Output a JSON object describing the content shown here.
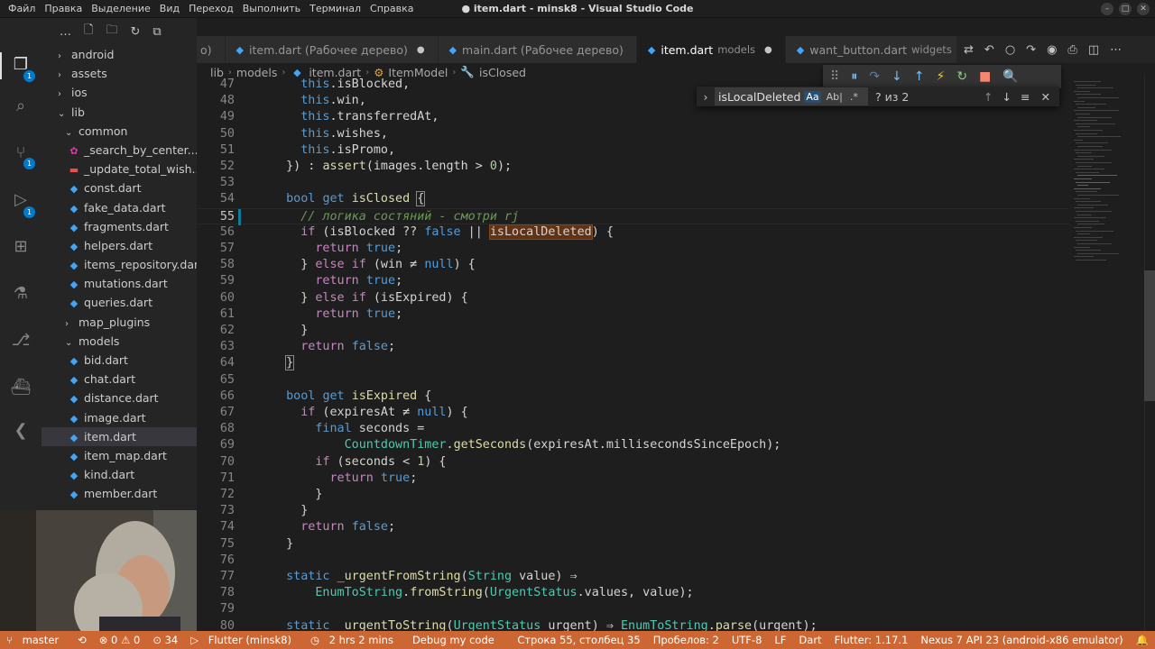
{
  "window": {
    "title": "● item.dart - minsk8 - Visual Studio Code",
    "menu": [
      "Файл",
      "Правка",
      "Выделение",
      "Вид",
      "Переход",
      "Выполнить",
      "Терминал",
      "Справка"
    ]
  },
  "activity_bar": {
    "items": [
      {
        "icon": "files-icon",
        "badge": "1"
      },
      {
        "icon": "search-icon"
      },
      {
        "icon": "source-control-icon",
        "badge": "1"
      },
      {
        "icon": "run-debug-icon",
        "badge": "1"
      },
      {
        "icon": "extensions-icon"
      },
      {
        "icon": "testing-icon"
      },
      {
        "icon": "git-graph-icon"
      },
      {
        "icon": "docker-icon"
      },
      {
        "icon": "flutter-icon"
      }
    ]
  },
  "sidebar": {
    "tree": [
      {
        "label": "android",
        "type": "folder",
        "level": 1,
        "expanded": false
      },
      {
        "label": "assets",
        "type": "folder",
        "level": 1,
        "expanded": false
      },
      {
        "label": "ios",
        "type": "folder",
        "level": 1,
        "expanded": false
      },
      {
        "label": "lib",
        "type": "folder",
        "level": 1,
        "expanded": true
      },
      {
        "label": "common",
        "type": "folder",
        "level": 2,
        "expanded": true
      },
      {
        "label": "_search_by_center....",
        "type": "graphql",
        "level": 3
      },
      {
        "label": "_update_total_wish...",
        "type": "red",
        "level": 3
      },
      {
        "label": "const.dart",
        "type": "dart",
        "level": 3
      },
      {
        "label": "fake_data.dart",
        "type": "dart",
        "level": 3
      },
      {
        "label": "fragments.dart",
        "type": "dart",
        "level": 3
      },
      {
        "label": "helpers.dart",
        "type": "dart",
        "level": 3
      },
      {
        "label": "items_repository.dart",
        "type": "dart",
        "level": 3
      },
      {
        "label": "mutations.dart",
        "type": "dart",
        "level": 3
      },
      {
        "label": "queries.dart",
        "type": "dart",
        "level": 3
      },
      {
        "label": "map_plugins",
        "type": "folder",
        "level": 2,
        "expanded": false
      },
      {
        "label": "models",
        "type": "folder",
        "level": 2,
        "expanded": true
      },
      {
        "label": "bid.dart",
        "type": "dart",
        "level": 3
      },
      {
        "label": "chat.dart",
        "type": "dart",
        "level": 3
      },
      {
        "label": "distance.dart",
        "type": "dart",
        "level": 3
      },
      {
        "label": "image.dart",
        "type": "dart",
        "level": 3
      },
      {
        "label": "item.dart",
        "type": "dart",
        "level": 3,
        "selected": true
      },
      {
        "label": "item_map.dart",
        "type": "dart",
        "level": 3
      },
      {
        "label": "kind.dart",
        "type": "dart",
        "level": 3
      },
      {
        "label": "member.dart",
        "type": "dart",
        "level": 3
      }
    ]
  },
  "tabs": [
    {
      "label": "o)",
      "desc": "",
      "modified": false,
      "active": false
    },
    {
      "label": "item.dart (Рабочее дерево)",
      "desc": "",
      "modified": true,
      "active": false
    },
    {
      "label": "main.dart (Рабочее дерево)",
      "desc": "",
      "modified": false,
      "active": false
    },
    {
      "label": "item.dart",
      "desc": "models",
      "modified": true,
      "active": true
    },
    {
      "label": "want_button.dart",
      "desc": "widgets",
      "modified": false,
      "active": false
    }
  ],
  "breadcrumb": [
    "lib",
    "models",
    "item.dart",
    "ItemModel",
    "isClosed"
  ],
  "find": {
    "value": "isLocalDeleted",
    "opts": [
      "Aa",
      "Ab|",
      ".*"
    ],
    "result": "? из 2"
  },
  "editor": {
    "current_line": 55,
    "lines": [
      {
        "n": "47",
        "html": "    <span class='kw'>this</span>.isBlocked,"
      },
      {
        "n": "48",
        "html": "    <span class='kw'>this</span>.win,"
      },
      {
        "n": "49",
        "html": "    <span class='kw'>this</span>.transferredAt,"
      },
      {
        "n": "50",
        "html": "    <span class='kw'>this</span>.wishes,"
      },
      {
        "n": "51",
        "html": "    <span class='kw'>this</span>.isPromo,"
      },
      {
        "n": "52",
        "html": "  }) : <span class='fn'>assert</span>(images.length &gt; <span class='num'>0</span>);"
      },
      {
        "n": "53",
        "html": ""
      },
      {
        "n": "54",
        "html": "  <span class='kw'>bool</span> <span class='kw'>get</span> <span class='fn'>isClosed</span> <span class='brk'>{</span>"
      },
      {
        "n": "55",
        "html": "    <span class='cm'>// логика состяний - смотри rj</span>"
      },
      {
        "n": "56",
        "html": "    <span class='ctl'>if</span> (isBlocked ?? <span class='kw'>false</span> || <span class='hl'>isLocalDeleted</span>) {"
      },
      {
        "n": "57",
        "html": "      <span class='ctl'>return</span> <span class='kw'>true</span>;"
      },
      {
        "n": "58",
        "html": "    } <span class='ctl'>else</span> <span class='ctl'>if</span> (win ≠ <span class='kw'>null</span>) {"
      },
      {
        "n": "59",
        "html": "      <span class='ctl'>return</span> <span class='kw'>true</span>;"
      },
      {
        "n": "60",
        "html": "    } <span class='ctl'>else</span> <span class='ctl'>if</span> (isExpired) {"
      },
      {
        "n": "61",
        "html": "      <span class='ctl'>return</span> <span class='kw'>true</span>;"
      },
      {
        "n": "62",
        "html": "    }"
      },
      {
        "n": "63",
        "html": "    <span class='ctl'>return</span> <span class='kw'>false</span>;"
      },
      {
        "n": "64",
        "html": "  <span class='brk'>}</span>"
      },
      {
        "n": "65",
        "html": ""
      },
      {
        "n": "66",
        "html": "  <span class='kw'>bool</span> <span class='kw'>get</span> <span class='fn'>isExpired</span> {"
      },
      {
        "n": "67",
        "html": "    <span class='ctl'>if</span> (expiresAt ≠ <span class='kw'>null</span>) {"
      },
      {
        "n": "68",
        "html": "      <span class='kw'>final</span> seconds ="
      },
      {
        "n": "69",
        "html": "          <span class='ty'>CountdownTimer</span>.<span class='fn'>getSeconds</span>(expiresAt.millisecondsSinceEpoch);"
      },
      {
        "n": "70",
        "html": "      <span class='ctl'>if</span> (seconds &lt; <span class='num'>1</span>) {"
      },
      {
        "n": "71",
        "html": "        <span class='ctl'>return</span> <span class='kw'>true</span>;"
      },
      {
        "n": "72",
        "html": "      }"
      },
      {
        "n": "73",
        "html": "    }"
      },
      {
        "n": "74",
        "html": "    <span class='ctl'>return</span> <span class='kw'>false</span>;"
      },
      {
        "n": "75",
        "html": "  }"
      },
      {
        "n": "76",
        "html": ""
      },
      {
        "n": "77",
        "html": "  <span class='kw'>static</span> <span class='fn'>_urgentFromString</span>(<span class='ty'>String</span> value) ⇒"
      },
      {
        "n": "78",
        "html": "      <span class='ty'>EnumToString</span>.<span class='fn'>fromString</span>(<span class='ty'>UrgentStatus</span>.values, value);"
      },
      {
        "n": "79",
        "html": ""
      },
      {
        "n": "80",
        "html": "  <span class='kw'>static</span> <span class='fn'>_urgentToString</span>(<span class='ty'>UrgentStatus</span> urgent) ⇒ <span class='ty'>EnumToString</span>.<span class='fn'>parse</span>(urgent);"
      }
    ]
  },
  "statusbar": {
    "branch": "master",
    "sync": "⟲",
    "problems": "⊗ 0 ⚠ 0",
    "ports": "⊙ 34",
    "debug": "Flutter (minsk8)",
    "time": "2 hrs 2 mins",
    "debug_mode": "Debug my code",
    "position": "Строка 55, столбец 35",
    "spaces": "Пробелов: 2",
    "encoding": "UTF-8",
    "eol": "LF",
    "language": "Dart",
    "flutter": "Flutter: 1.17.1",
    "device": "Nexus 7 API 23 (android-x86 emulator)"
  }
}
